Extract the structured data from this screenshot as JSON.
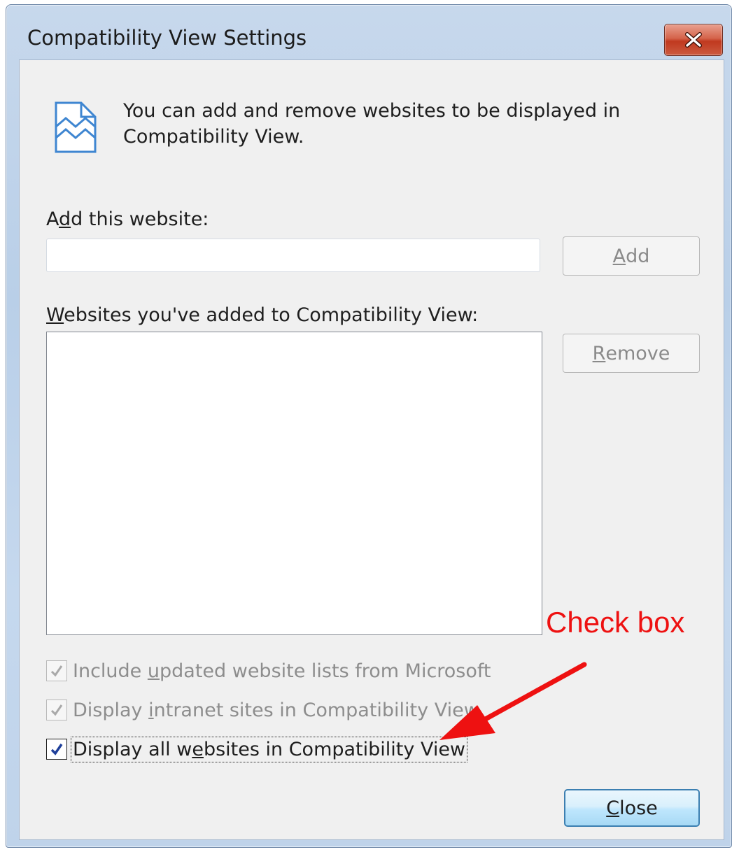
{
  "window": {
    "title": "Compatibility View Settings",
    "close_icon": "close-icon"
  },
  "info": {
    "icon": "compatibility-view-icon",
    "text": "You can add and remove websites to be displayed in Compatibility View."
  },
  "add_section": {
    "label_pre": "A",
    "label_accel": "d",
    "label_post": "d this website:",
    "input_value": "",
    "add_button_accel": "A",
    "add_button_rest": "dd"
  },
  "list_section": {
    "label_accel": "W",
    "label_post": "ebsites you've added to Compatibility View:",
    "items": [],
    "remove_button_accel": "R",
    "remove_button_rest": "emove"
  },
  "options": {
    "include_updated": {
      "pre": "Include ",
      "accel": "u",
      "post": "pdated website lists from Microsoft",
      "checked": true,
      "enabled": false
    },
    "display_intranet": {
      "pre": "Display ",
      "accel": "i",
      "post": "ntranet sites in Compatibility View",
      "checked": true,
      "enabled": false
    },
    "display_all": {
      "pre": "Display all w",
      "accel": "e",
      "post": "bsites in Compatibility View",
      "checked": true,
      "enabled": true
    }
  },
  "footer": {
    "close_accel": "C",
    "close_rest": "lose"
  },
  "annotation": {
    "text": "Check box",
    "color": "#ee1111"
  }
}
